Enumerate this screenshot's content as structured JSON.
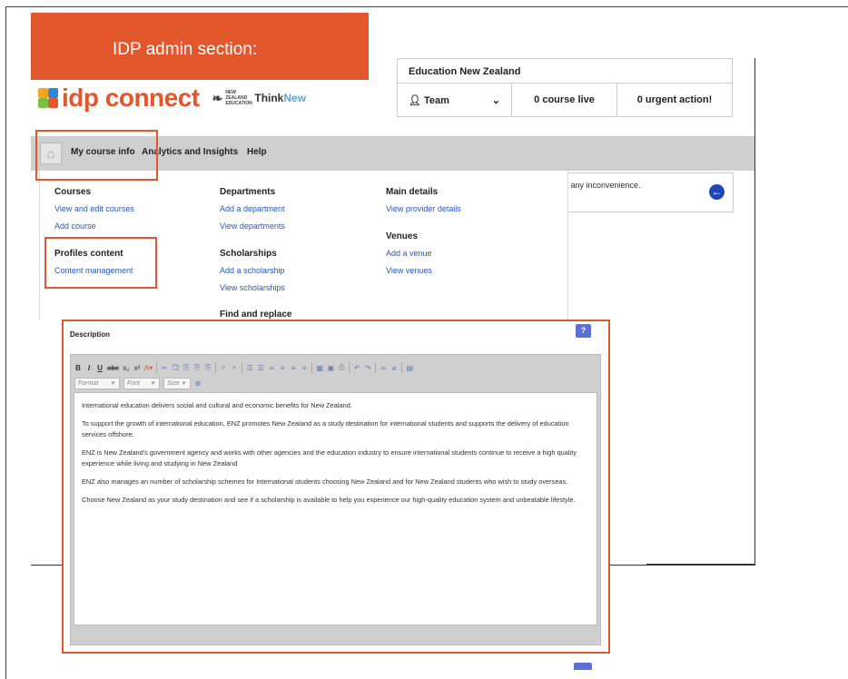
{
  "banner": {
    "title": "IDP admin section:"
  },
  "logo": {
    "brand": "idp connect",
    "nz_text": "NEW ZEALAND EDUCATION",
    "think": "Think",
    "new": "New"
  },
  "org": {
    "name": "Education New Zealand",
    "team_label": "Team",
    "courses_live": "0 course live",
    "urgent": "0 urgent action!"
  },
  "nav": {
    "items": [
      {
        "label": "My course info"
      },
      {
        "label": "Analytics and Insights"
      },
      {
        "label": "Help"
      }
    ]
  },
  "notice": {
    "text": "r any inconvenience."
  },
  "menu": {
    "courses": {
      "heading": "Courses",
      "links": [
        "View and edit courses",
        "Add course"
      ]
    },
    "profiles": {
      "heading": "Profiles content",
      "links": [
        "Content management"
      ]
    },
    "departments": {
      "heading": "Departments",
      "links": [
        "Add a department",
        "View departments"
      ]
    },
    "scholarships": {
      "heading": "Scholarships",
      "links": [
        "Add a scholarship",
        "View scholarships"
      ]
    },
    "find": {
      "heading": "Find and replace"
    },
    "main_details": {
      "heading": "Main details",
      "links": [
        "View provider details"
      ]
    },
    "venues": {
      "heading": "Venues",
      "links": [
        "Add a venue",
        "View venues"
      ]
    }
  },
  "editor": {
    "label": "Description",
    "help": "?",
    "format_placeholder": "Format",
    "font_placeholder": "Font",
    "size_placeholder": "Size",
    "paragraphs": [
      "International education delivers social and cultural and economic benefits for New Zealand.",
      "To support the growth of international education, ENZ promotes New Zealand as a study destination for international students and supports the delivery of education services offshore.",
      "ENZ is New Zealand's government agency and works with other agencies and the education industry to ensure international students continue to receive a high quality experience while living and studying in New Zealand",
      "ENZ also manages an number of scholarship schemes for International students choosing New Zealand and for New Zealand students who wish to study overseas.",
      "Choose New Zealand as your study destination and see if a scholarship is available to help you experience our high-quality education system and unbeatable lifestyle."
    ]
  },
  "colors": {
    "accent": "#e2572b",
    "link": "#2a57b8",
    "nav_bg": "#cfcfcf",
    "help_badge": "#5b6fd8"
  }
}
